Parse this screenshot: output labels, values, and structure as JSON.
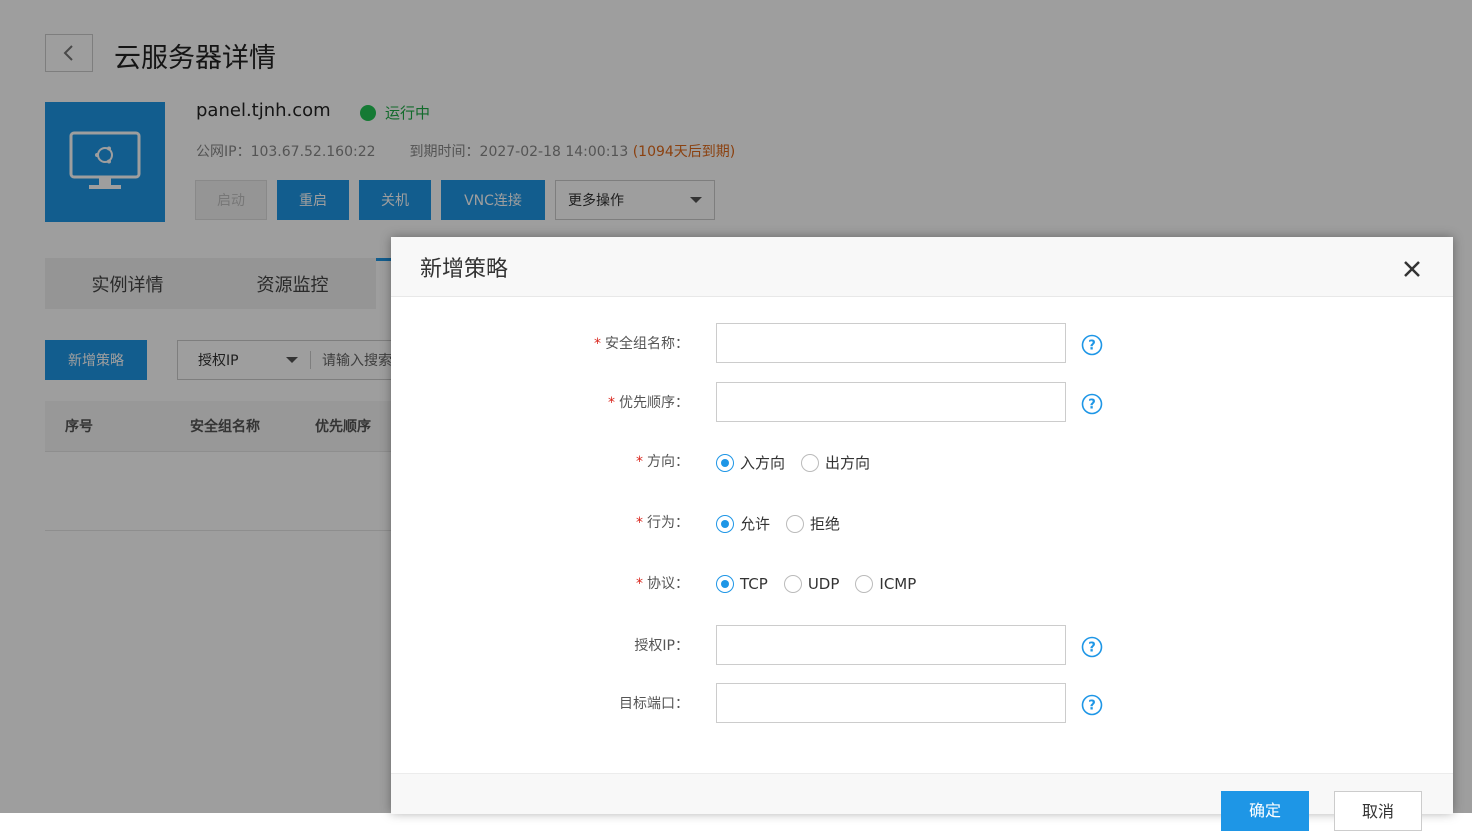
{
  "header": {
    "title": "云服务器详情"
  },
  "server": {
    "hostname": "panel.tjnh.com",
    "status": "运行中",
    "public_ip_label": "公网IP：",
    "public_ip": "103.67.52.160:22",
    "expire_label": "到期时间：",
    "expire_time": "2027-02-18 14:00:13",
    "expire_note": "(1094天后到期)"
  },
  "actions": {
    "start": "启动",
    "restart": "重启",
    "shutdown": "关机",
    "vnc": "VNC连接",
    "more": "更多操作"
  },
  "tabs": [
    {
      "label": "实例详情"
    },
    {
      "label": "资源监控"
    }
  ],
  "toolbar": {
    "add_policy": "新增策略",
    "filter_select": "授权IP",
    "search_placeholder": "请输入搜索"
  },
  "table": {
    "columns": [
      "序号",
      "安全组名称",
      "优先顺序"
    ]
  },
  "modal": {
    "title": "新增策略",
    "fields": {
      "name": {
        "label": "安全组名称：",
        "value": ""
      },
      "priority": {
        "label": "优先顺序：",
        "value": ""
      },
      "direction": {
        "label": "方向：",
        "options": [
          "入方向",
          "出方向"
        ],
        "selected": "入方向"
      },
      "action": {
        "label": "行为：",
        "options": [
          "允许",
          "拒绝"
        ],
        "selected": "允许"
      },
      "protocol": {
        "label": "协议：",
        "options": [
          "TCP",
          "UDP",
          "ICMP"
        ],
        "selected": "TCP"
      },
      "auth_ip": {
        "label": "授权IP：",
        "value": ""
      },
      "target_port": {
        "label": "目标端口：",
        "value": ""
      }
    },
    "confirm": "确定",
    "cancel": "取消"
  },
  "colors": {
    "primary": "#1e96e6",
    "running": "#22c554",
    "expire_note": "#e06a1b",
    "required": "#d9241b"
  },
  "icons": [
    "chevron-left-icon",
    "monitor-icon",
    "ubuntu-logo-icon",
    "caret-down-icon",
    "close-icon",
    "help-icon"
  ]
}
